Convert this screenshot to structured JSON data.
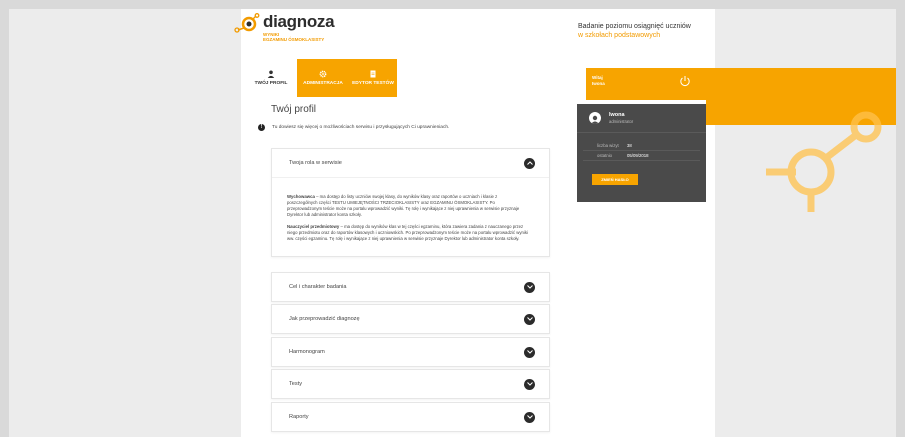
{
  "logo": {
    "word": "diagnoza",
    "sub1": "WYNIKI",
    "sub2": "EGZAMINU ÓSMOKLASISTY"
  },
  "tagline": {
    "line1": "Badanie poziomu osiągnięć uczniów",
    "line2": "w szkołach podstawowych"
  },
  "tabs": [
    {
      "label": "TWÓJ PROFIL",
      "icon": "user-icon",
      "active": true
    },
    {
      "label": "ADMINISTRACJA",
      "icon": "gear-icon",
      "active": false
    },
    {
      "label": "EDYTOR TESTÓW",
      "icon": "document-icon",
      "active": false
    }
  ],
  "profile": {
    "title": "Twój profil",
    "info": "Tu dowiesz się więcej o możliwościach serwisu i przysługujących Ci uprawnieniach."
  },
  "accordion": {
    "open": {
      "title": "Twoja rola w serwisie",
      "p1_bold": "Wychowawca",
      "p1_text": " – ma dostęp do listy uczniów swojej klasy, do wyników klasy oraz raportów o uczniach i klasie z poszczególnych części TESTU UMIEJĘTNOŚCI TRZECIOKLASISTY oraz EGZAMINU ÓSMOKLASISTY. Po przeprowadzonym teście może na portalu wprowadzić wyniki. Tę rolę i wynikające z niej uprawnienia w serwisie przyznaje Dyrektor lub administrator konta szkoły.",
      "p2_bold": "Nauczyciel przedmiotowy",
      "p2_text": " – ma dostęp do wyników klas w tej części egzaminu, która zawiera zadania z nauczanego przez niego przedmiotu oraz do raportów klasowych i uczniowskich. Po przeprowadzonym teście może na portalu wprowadzić wyniki ww. części egzaminu. Tę rolę i wynikające z niej uprawnienia w serwisie przyznaje Dyrektor lub administrator konta szkoły."
    },
    "sections": [
      "Cel i charakter badania",
      "Jak przeprowadzić diagnozę",
      "Harmonogram",
      "Testy",
      "Raporty"
    ]
  },
  "user": {
    "welcome1": "Witaj",
    "welcome2": "Iwona",
    "name": "Iwona",
    "role": "administrator",
    "visits_label": "liczba wizyt",
    "visits_value": "38",
    "last_label": "ostatnio",
    "last_value": "05/09/2018",
    "change_password": "ZMIEŃ HASŁO"
  },
  "colors": {
    "accent": "#f7a400",
    "panel": "#4a4a4a"
  }
}
